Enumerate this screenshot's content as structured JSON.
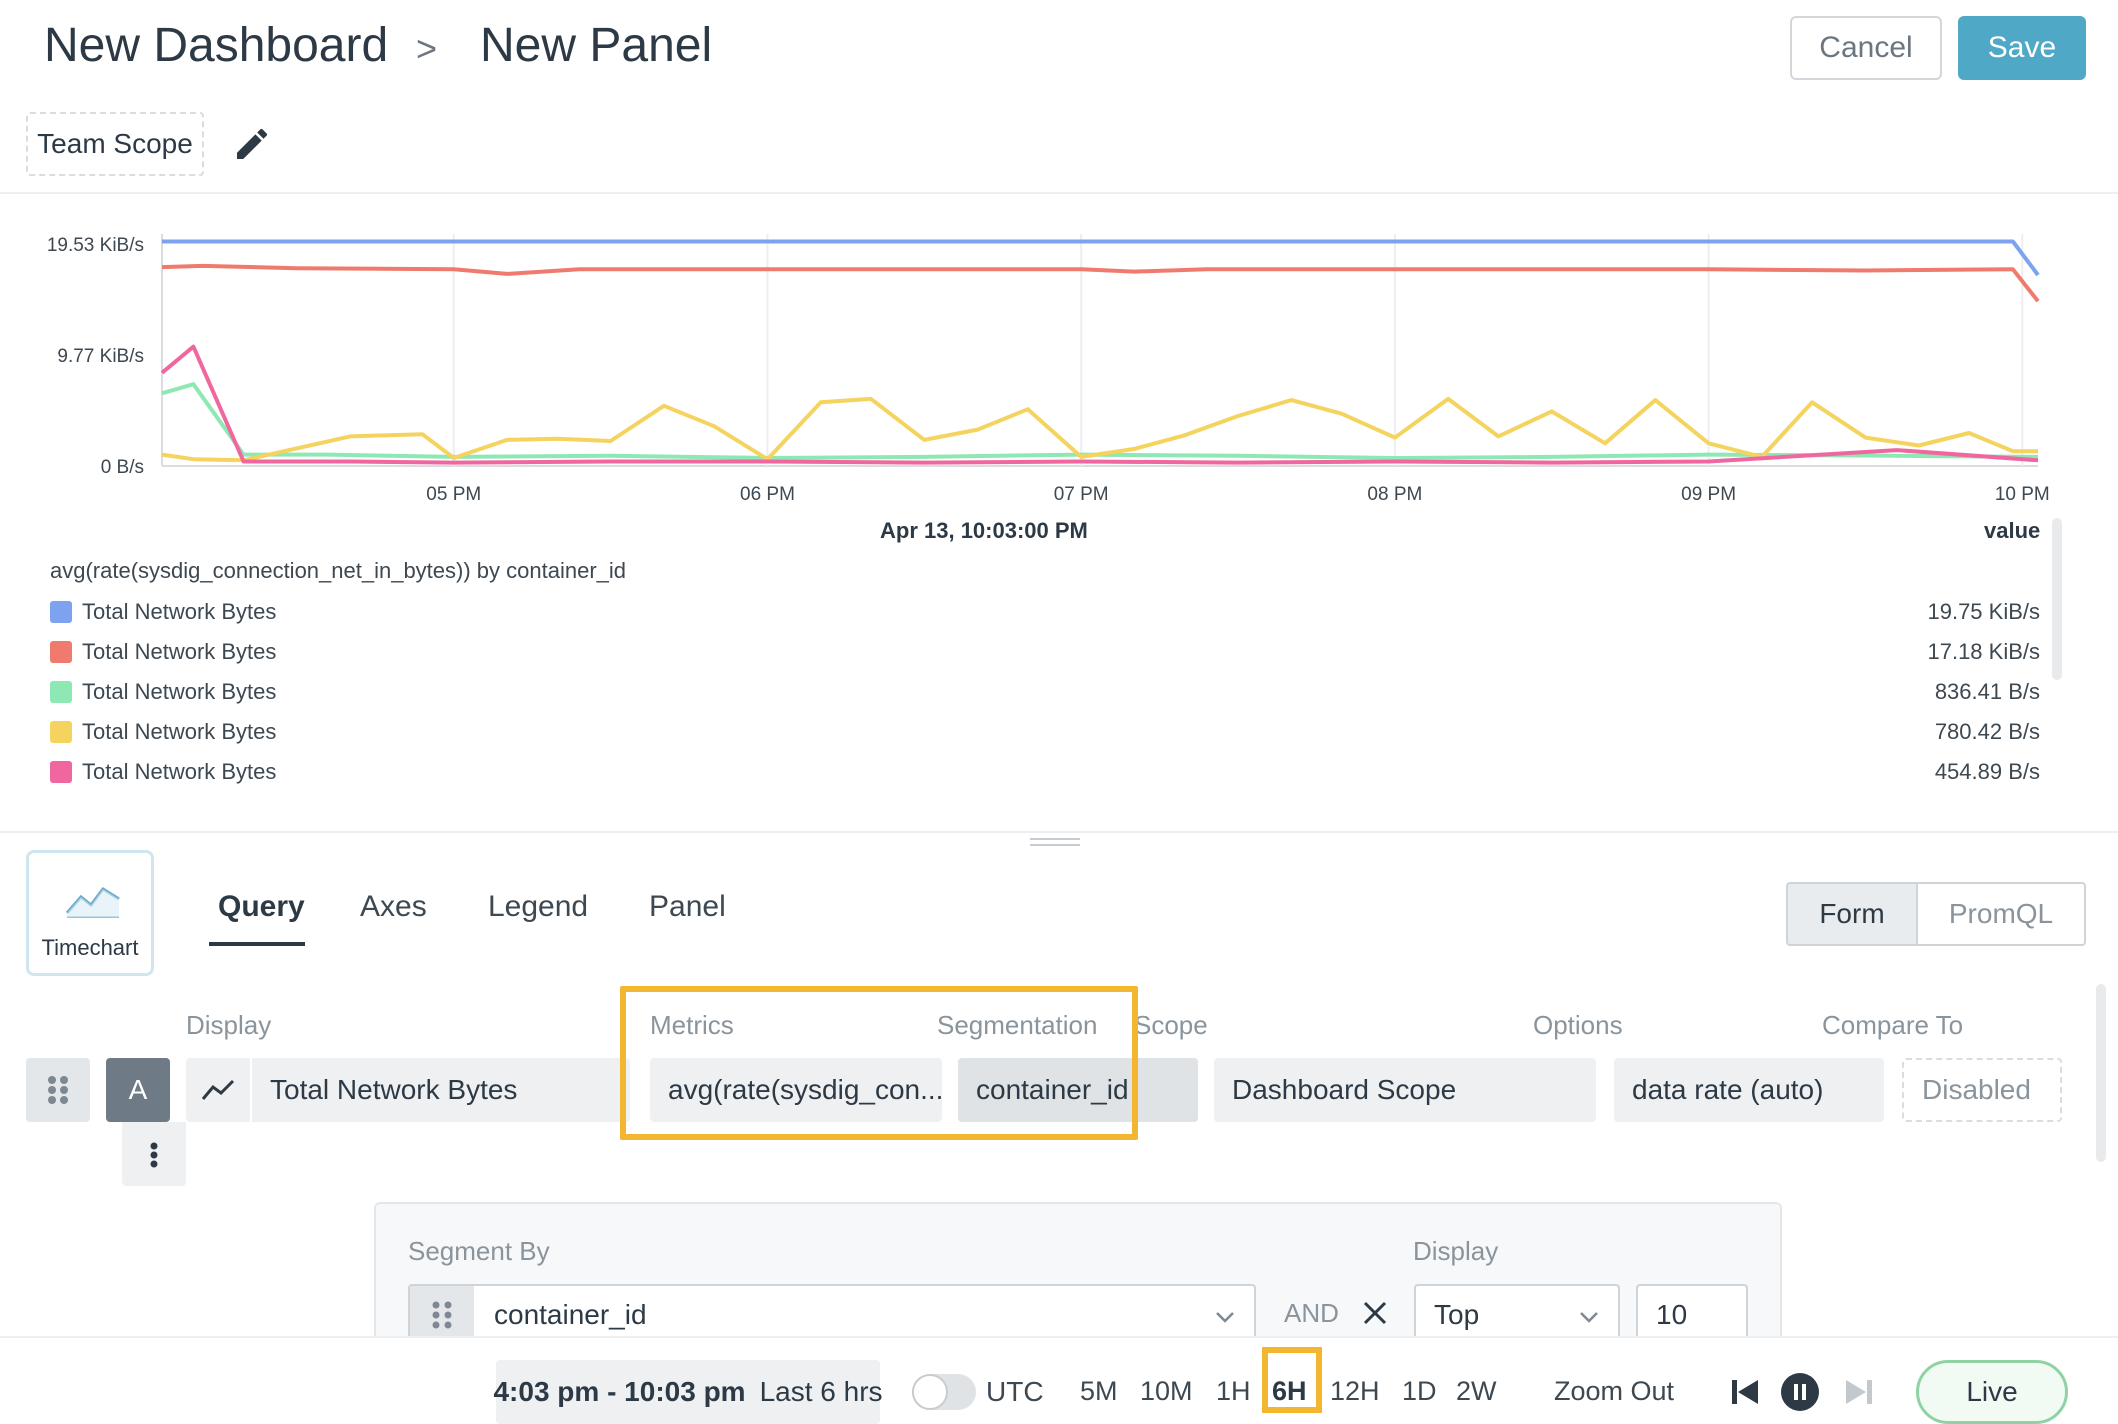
{
  "header": {
    "breadcrumb_parent": "New Dashboard",
    "breadcrumb_separator": ">",
    "breadcrumb_current": "New Panel",
    "cancel_label": "Cancel",
    "save_label": "Save",
    "scope_label": "Team Scope",
    "accent_color": "#4fa8c5"
  },
  "chart_data": {
    "type": "line",
    "title": "",
    "xlabel": "",
    "ylabel": "",
    "y_tick_labels": [
      "19.53 KiB/s",
      "9.77 KiB/s",
      "0 B/s"
    ],
    "y_tick_values": [
      19.53,
      9.77,
      0
    ],
    "y_unit": "KiB/s",
    "ylim": [
      0,
      19.53
    ],
    "x_tick_labels": [
      "05 PM",
      "06 PM",
      "07 PM",
      "08 PM",
      "09 PM",
      "10 PM"
    ],
    "x_tick_values": [
      17,
      18,
      19,
      20,
      21,
      22
    ],
    "x_unit": "hour of day",
    "xlim": [
      16.07,
      22.05
    ],
    "grid": "vertical",
    "series": [
      {
        "color": "#7da3f0",
        "x": [
          16.07,
          17,
          18,
          19,
          20,
          21,
          21.97,
          22.05
        ],
        "values": [
          19.75,
          19.75,
          19.75,
          19.75,
          19.75,
          19.75,
          19.75,
          16.8
        ]
      },
      {
        "color": "#f07a6e",
        "x": [
          16.07,
          16.2,
          16.5,
          17,
          17.17,
          17.4,
          18,
          19,
          19.17,
          19.4,
          20,
          20.4,
          21,
          21.5,
          21.97,
          22.05
        ],
        "values": [
          17.5,
          17.6,
          17.4,
          17.3,
          16.9,
          17.3,
          17.3,
          17.3,
          17.1,
          17.3,
          17.3,
          17.3,
          17.3,
          17.2,
          17.3,
          14.5
        ]
      },
      {
        "color": "#8ee8b4",
        "x": [
          16.07,
          16.17,
          16.33,
          16.6,
          17,
          17.5,
          18,
          18.5,
          19,
          19.5,
          20,
          20.5,
          21,
          21.6,
          22.05
        ],
        "values": [
          6.4,
          7.2,
          1.0,
          1.0,
          0.8,
          0.9,
          0.7,
          0.8,
          1.0,
          0.9,
          0.7,
          0.8,
          1.0,
          0.9,
          0.8
        ]
      },
      {
        "color": "#f4d35e",
        "x": [
          16.07,
          16.17,
          16.33,
          16.67,
          16.9,
          17,
          17.17,
          17.33,
          17.5,
          17.67,
          17.83,
          18,
          18.17,
          18.33,
          18.5,
          18.67,
          18.83,
          19,
          19.17,
          19.33,
          19.5,
          19.67,
          19.83,
          20,
          20.17,
          20.33,
          20.5,
          20.67,
          20.83,
          21,
          21.17,
          21.33,
          21.5,
          21.67,
          21.83,
          21.97,
          22.05
        ],
        "values": [
          1.0,
          0.6,
          0.5,
          2.6,
          2.8,
          0.7,
          2.3,
          2.4,
          2.2,
          5.3,
          3.5,
          0.6,
          5.6,
          5.9,
          2.3,
          3.2,
          5.0,
          0.8,
          1.5,
          2.7,
          4.4,
          5.8,
          4.6,
          2.5,
          5.9,
          2.6,
          4.8,
          2.0,
          5.8,
          2.0,
          0.8,
          5.6,
          2.5,
          1.8,
          2.9,
          1.3,
          1.3
        ]
      },
      {
        "color": "#f0679f",
        "x": [
          16.07,
          16.17,
          16.33,
          16.67,
          17,
          17.5,
          18,
          18.5,
          19,
          19.5,
          20,
          20.5,
          21,
          21.6,
          22.05
        ],
        "values": [
          8.2,
          10.5,
          0.4,
          0.4,
          0.3,
          0.4,
          0.4,
          0.3,
          0.4,
          0.3,
          0.4,
          0.3,
          0.4,
          1.4,
          0.5
        ]
      }
    ]
  },
  "legend": {
    "timestamp": "Apr 13, 10:03:00 PM",
    "value_header": "value",
    "query": "avg(rate(sysdig_connection_net_in_bytes)) by container_id",
    "rows": [
      {
        "name": "Total Network Bytes",
        "value": "19.75 KiB/s",
        "color": "#7da3f0"
      },
      {
        "name": "Total Network Bytes",
        "value": "17.18 KiB/s",
        "color": "#f07a6e"
      },
      {
        "name": "Total Network Bytes",
        "value": "836.41 B/s",
        "color": "#8ee8b4"
      },
      {
        "name": "Total Network Bytes",
        "value": "780.42 B/s",
        "color": "#f4d35e"
      },
      {
        "name": "Total Network Bytes",
        "value": "454.89 B/s",
        "color": "#f0679f"
      }
    ]
  },
  "editor": {
    "viz_type_label": "Timechart",
    "tabs": [
      "Query",
      "Axes",
      "Legend",
      "Panel"
    ],
    "active_tab": "Query",
    "mode_options": [
      "Form",
      "PromQL"
    ],
    "active_mode": "Form",
    "columns": {
      "display": "Display",
      "metrics": "Metrics",
      "segmentation": "Segmentation",
      "scope": "Scope",
      "options": "Options",
      "compare_to": "Compare To"
    },
    "query_row": {
      "letter": "A",
      "display": "Total Network Bytes",
      "metric": "avg(rate(sysdig_con...",
      "segmentation": "container_id",
      "scope": "Dashboard Scope",
      "options": "data rate (auto)",
      "compare_to": "Disabled"
    },
    "segment_panel": {
      "segment_by_label": "Segment By",
      "segment_by_value": "container_id",
      "and_label": "AND",
      "display_label": "Display",
      "display_value": "Top",
      "display_count": "10"
    },
    "highlight_color": "#f2b630"
  },
  "footer": {
    "time_start": "4:03 pm - 10:03 pm",
    "time_desc": "Last 6 hrs",
    "utc_label": "UTC",
    "utc_enabled": false,
    "ranges": [
      "5M",
      "10M",
      "1H",
      "6H",
      "12H",
      "1D",
      "2W"
    ],
    "selected_range": "6H",
    "zoom_out_label": "Zoom Out",
    "live_label": "Live"
  }
}
